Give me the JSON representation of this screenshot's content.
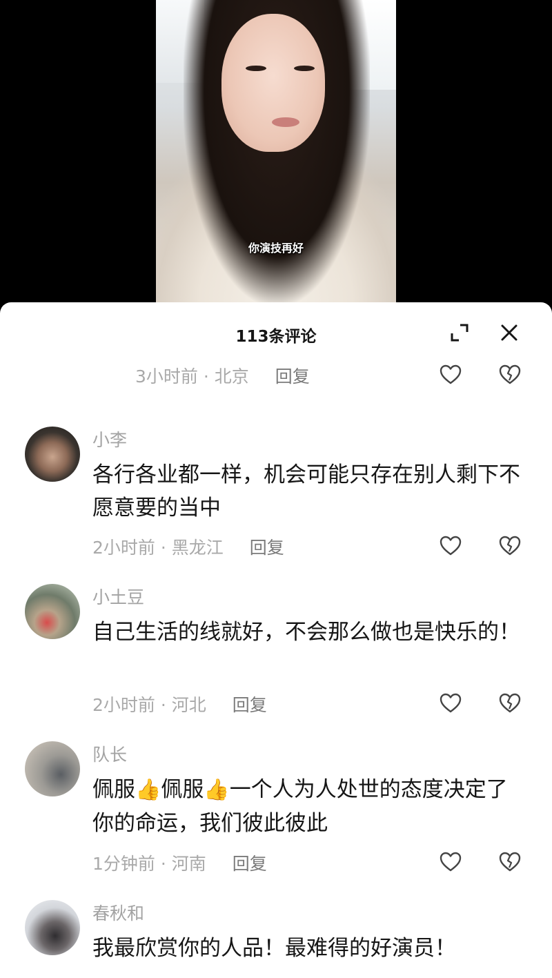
{
  "video": {
    "subtitle": "你演技再好"
  },
  "comments_panel": {
    "title": "113条评论",
    "expand_icon": "expand-icon",
    "close_icon": "close-icon",
    "top_meta": {
      "time_location": "3小时前 · 北京",
      "reply_label": "回复"
    },
    "comments": [
      {
        "username": "小李",
        "text": "各行各业都一样，机会可能只存在别人剩下不愿意要的当中",
        "time_location": "2小时前 · 黑龙江",
        "reply_label": "回复"
      },
      {
        "username": "小土豆",
        "text": "自己生活的线就好，不会那么做也是快乐的！",
        "time_location": "2小时前 · 河北",
        "reply_label": "回复"
      },
      {
        "username": "队长",
        "text_parts": [
          "佩服",
          "👍",
          "佩服",
          "👍",
          "一个人为人处世的态度决定了你的命运，我们彼此彼此"
        ],
        "time_location": "1分钟前 · 河南",
        "reply_label": "回复"
      },
      {
        "username": "春秋和",
        "text": "我最欣赏你的人品！最难得的好演员！"
      }
    ]
  },
  "icons": {
    "like": "heart-outline-icon",
    "dislike": "broken-heart-icon"
  }
}
